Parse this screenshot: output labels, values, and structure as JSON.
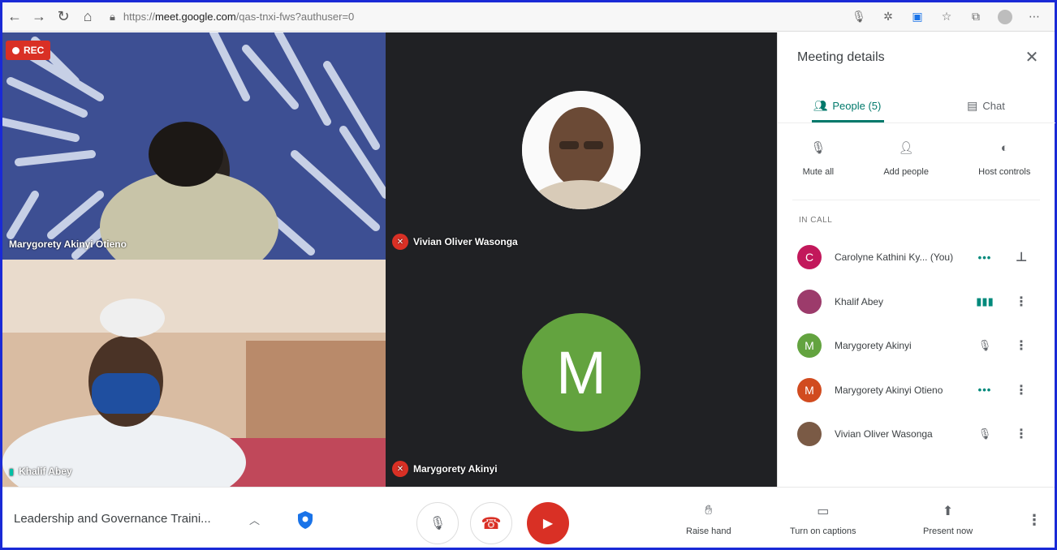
{
  "browser": {
    "url_prefix": "https://",
    "url_host": "meet.google.com",
    "url_path": "/qas-tnxi-fws?authuser=0"
  },
  "recording": {
    "label": "REC"
  },
  "tiles": [
    {
      "name": "Marygorety Akinyi Otieno"
    },
    {
      "name": "Vivian Oliver Wasonga"
    },
    {
      "name": "Khalif Abey"
    },
    {
      "name": "Marygorety Akinyi",
      "avatar_letter": "M",
      "avatar_color": "#63a33f"
    }
  ],
  "panel": {
    "title": "Meeting details",
    "tabs": [
      {
        "label": "People (5)",
        "active": true
      },
      {
        "label": "Chat",
        "active": false
      }
    ],
    "actions": [
      {
        "label": "Mute all",
        "icon": "mic-off-icon"
      },
      {
        "label": "Add people",
        "icon": "add-person-icon"
      },
      {
        "label": "Host controls",
        "icon": "toggle-icon"
      }
    ],
    "section_label": "IN CALL",
    "participants": [
      {
        "name": "Carolyne Kathini Ky...",
        "suffix": "(You)",
        "avatar_letter": "C",
        "avatar_color": "#c2185b",
        "status": "more-dots"
      },
      {
        "name": "Khalif Abey",
        "avatar_letter": "",
        "avatar_color": "#9c3b6b",
        "status": "speaking"
      },
      {
        "name": "Marygorety Akinyi",
        "avatar_letter": "M",
        "avatar_color": "#63a33f",
        "status": "muted"
      },
      {
        "name": "Marygorety Akinyi Otieno",
        "avatar_letter": "M",
        "avatar_color": "#d14b1f",
        "status": "more-dots"
      },
      {
        "name": "Vivian Oliver Wasonga",
        "avatar_letter": "",
        "avatar_color": "#7a5a45",
        "status": "muted"
      }
    ]
  },
  "toolbar": {
    "meeting_name": "Leadership and Governance Traini...",
    "raise_hand": "Raise hand",
    "captions": "Turn on captions",
    "present": "Present now"
  },
  "colors": {
    "accent": "#00796b",
    "danger": "#d93025",
    "frame": "#1a2ad6"
  }
}
